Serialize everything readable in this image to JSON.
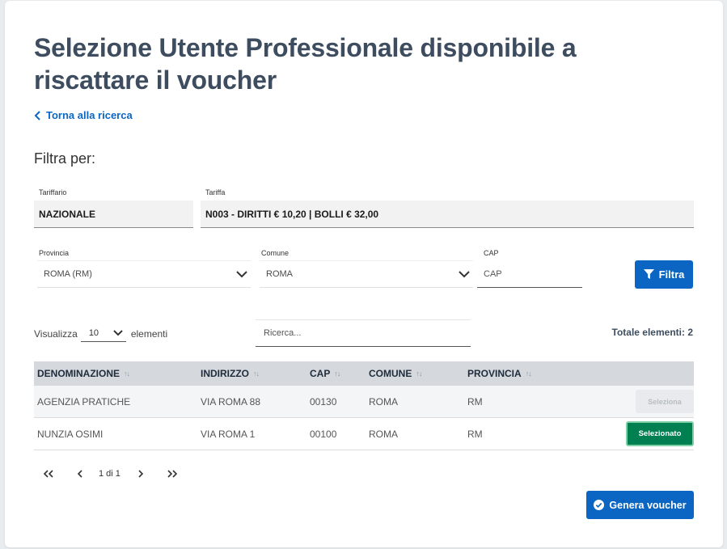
{
  "page": {
    "title": "Selezione Utente Professionale disponibile a riscattare il voucher",
    "back_link": "Torna alla ricerca",
    "filter_heading": "Filtra per:"
  },
  "filters": {
    "tariffario": {
      "label": "Tariffario",
      "value": "NAZIONALE"
    },
    "tariffa": {
      "label": "Tariffa",
      "value": "N003 - DIRITTI € 10,20 | BOLLI € 32,00"
    },
    "provincia": {
      "label": "Provincia",
      "value": "ROMA (RM)"
    },
    "comune": {
      "label": "Comune",
      "value": "ROMA"
    },
    "cap": {
      "label": "CAP",
      "placeholder": "CAP",
      "value": ""
    },
    "filter_button": "Filtra"
  },
  "list_controls": {
    "show_label": "Visualizza",
    "page_size": "10",
    "elements_label": "elementi",
    "search_placeholder": "Ricerca...",
    "total_label": "Totale elementi: 2"
  },
  "table": {
    "columns": [
      "DENOMINAZIONE",
      "INDIRIZZO",
      "CAP",
      "COMUNE",
      "PROVINCIA"
    ],
    "rows": [
      {
        "denominazione": "AGENZIA PRATICHE",
        "indirizzo": "VIA ROMA 88",
        "cap": "00130",
        "comune": "ROMA",
        "provincia": "RM",
        "action": "Seleziona",
        "selected": false
      },
      {
        "denominazione": "NUNZIA OSIMI",
        "indirizzo": "VIA ROMA 1",
        "cap": "00100",
        "comune": "ROMA",
        "provincia": "RM",
        "action": "Selezionato",
        "selected": true
      }
    ]
  },
  "pagination": {
    "first": "<<",
    "prev": "<",
    "label": "1 di 1",
    "next": ">",
    "last": ">>"
  },
  "generate_button": "Genera voucher",
  "colors": {
    "primary": "#0a66c2",
    "title": "#3d4c5e",
    "selected_green": "#008050",
    "header_bg": "#d5d9de"
  },
  "icons": {
    "back": "chevron-left-icon",
    "filter": "filter-funnel-icon",
    "dropdown": "chevron-down-icon",
    "sort": "sort-arrows-icon",
    "generate": "check-circle-icon"
  }
}
